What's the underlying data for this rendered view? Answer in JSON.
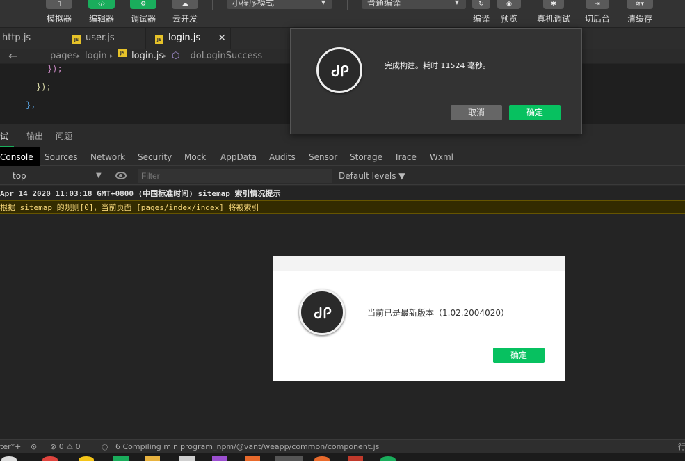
{
  "toolbar": {
    "simulator": "模拟器",
    "editor": "编辑器",
    "debugger": "调试器",
    "cloud": "云开发",
    "mode_select": "小程序模式",
    "compile_select": "普通编译",
    "compile": "编译",
    "preview": "预览",
    "remote_debug": "真机调试",
    "background": "切后台",
    "clear_cache": "清缓存"
  },
  "file_tabs": [
    {
      "name": "http.js"
    },
    {
      "name": "user.js"
    },
    {
      "name": "login.js",
      "close": "✕"
    }
  ],
  "breadcrumb": {
    "items": [
      "pages",
      "login",
      "login.js",
      "_doLoginSuccess"
    ]
  },
  "code": {
    "lines": [
      "});",
      "});",
      "},"
    ]
  },
  "devtools": {
    "tabs": [
      "试器",
      "输出",
      "问题"
    ],
    "panel_tabs": [
      "Console",
      "Sources",
      "Network",
      "Security",
      "Mock",
      "AppData",
      "Audits",
      "Sensor",
      "Storage",
      "Trace",
      "Wxml"
    ],
    "context": "top",
    "filter_placeholder": "Filter",
    "levels": "Default levels ▼"
  },
  "console": {
    "log": "Apr 14 2020 11:03:18 GMT+0800 (中国标准时间) sitemap 索引情况提示",
    "warning": "根据 sitemap 的规则[0]，当前页面 [pages/index/index] 将被索引"
  },
  "statusbar": {
    "left": "ter*+",
    "errors": "⊗ 0 ⚠ 0",
    "compiling": "6 Compiling miniprogram_npm/@vant/weapp/common/component.js",
    "right": "行"
  },
  "dialog_build": {
    "message": "完成构建。耗时 11524 毫秒。",
    "cancel": "取消",
    "confirm": "确定"
  },
  "dialog_version": {
    "message": "当前已是最新版本（1.02.2004020）",
    "confirm": "确定"
  },
  "colors": {
    "accent": "#07c160",
    "warning_bg": "#332b00"
  }
}
